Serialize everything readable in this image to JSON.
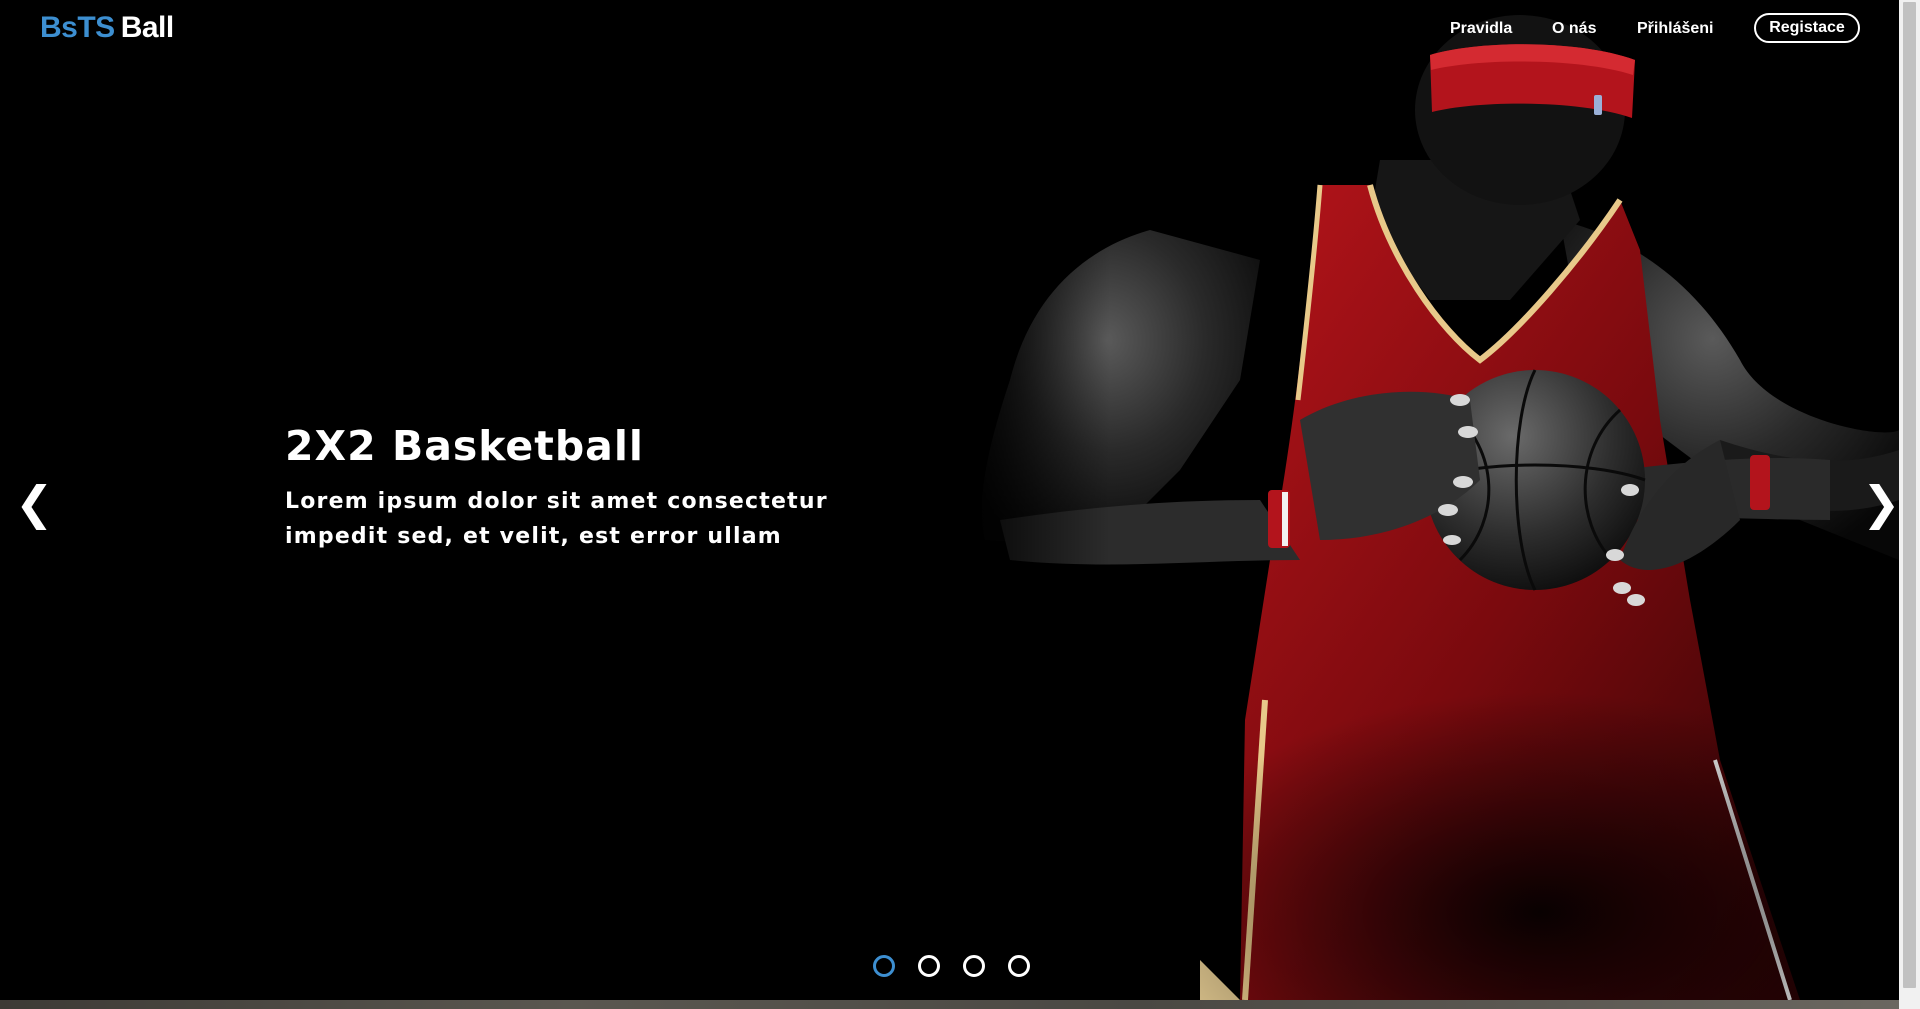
{
  "brand": {
    "part1": "BsTS",
    "part2": "Ball",
    "accent_color": "#3d8fd1"
  },
  "nav": {
    "links": [
      "Pravidla",
      "O nás",
      "Přihlášeni"
    ],
    "register_label": "Registace"
  },
  "hero": {
    "title": "2X2 Basketball",
    "text": "Lorem ipsum dolor sit amet consectetur impedit sed, et velit, est error ullam",
    "prev_icon": "chevron-left-icon",
    "next_icon": "chevron-right-icon",
    "slide_count": 4,
    "active_slide": 1
  }
}
